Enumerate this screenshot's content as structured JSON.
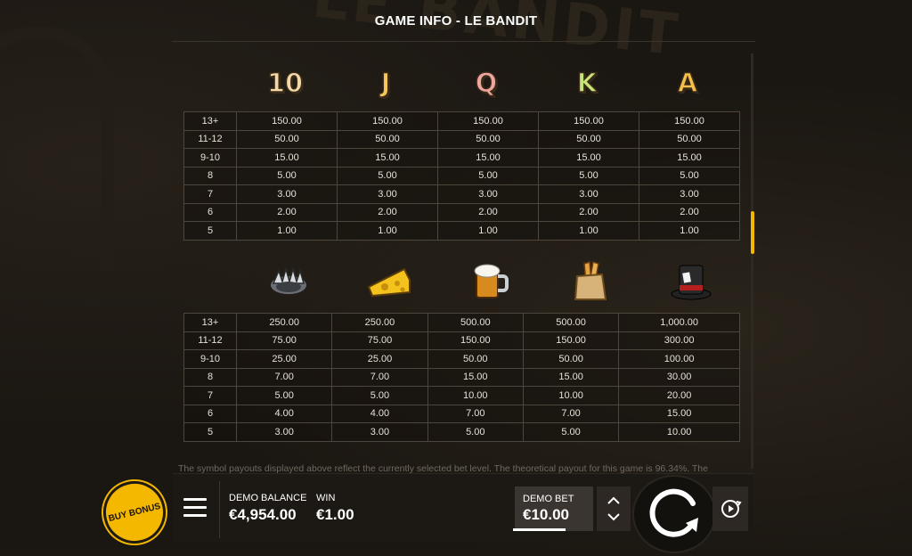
{
  "header": {
    "title": "GAME INFO - LE BANDIT"
  },
  "background": {
    "logo_text": "LE BANDIT"
  },
  "low_symbols": [
    {
      "name": "10",
      "color": "#f3d9a8"
    },
    {
      "name": "J",
      "color": "#f5c65a"
    },
    {
      "name": "Q",
      "color": "#f0a6a0"
    },
    {
      "name": "K",
      "color": "#c8e37a"
    },
    {
      "name": "A",
      "color": "#f6c14a"
    }
  ],
  "high_symbols": [
    {
      "name": "trap-icon"
    },
    {
      "name": "cheese-icon"
    },
    {
      "name": "beer-mug-icon"
    },
    {
      "name": "baguette-bag-icon"
    },
    {
      "name": "top-hat-icon"
    }
  ],
  "low_table": [
    [
      "13+",
      "150.00",
      "150.00",
      "150.00",
      "150.00",
      "150.00"
    ],
    [
      "11-12",
      "50.00",
      "50.00",
      "50.00",
      "50.00",
      "50.00"
    ],
    [
      "9-10",
      "15.00",
      "15.00",
      "15.00",
      "15.00",
      "15.00"
    ],
    [
      "8",
      "5.00",
      "5.00",
      "5.00",
      "5.00",
      "5.00"
    ],
    [
      "7",
      "3.00",
      "3.00",
      "3.00",
      "3.00",
      "3.00"
    ],
    [
      "6",
      "2.00",
      "2.00",
      "2.00",
      "2.00",
      "2.00"
    ],
    [
      "5",
      "1.00",
      "1.00",
      "1.00",
      "1.00",
      "1.00"
    ]
  ],
  "high_table": [
    [
      "13+",
      "250.00",
      "250.00",
      "500.00",
      "500.00",
      "1,000.00"
    ],
    [
      "11-12",
      "75.00",
      "75.00",
      "150.00",
      "150.00",
      "300.00"
    ],
    [
      "9-10",
      "25.00",
      "25.00",
      "50.00",
      "50.00",
      "100.00"
    ],
    [
      "8",
      "7.00",
      "7.00",
      "15.00",
      "15.00",
      "30.00"
    ],
    [
      "7",
      "5.00",
      "5.00",
      "10.00",
      "10.00",
      "20.00"
    ],
    [
      "6",
      "4.00",
      "4.00",
      "7.00",
      "7.00",
      "15.00"
    ],
    [
      "5",
      "3.00",
      "3.00",
      "5.00",
      "5.00",
      "10.00"
    ]
  ],
  "footnote": "The symbol payouts displayed above reflect the currently selected bet level. The theoretical payout for this game is 96.34%. The",
  "bottom": {
    "buy_bonus": "BUY BONUS",
    "balance_label": "DEMO BALANCE",
    "balance_value": "€4,954.00",
    "win_label": "WIN",
    "win_value": "€1.00",
    "bet_label": "DEMO BET",
    "bet_value": "€10.00"
  },
  "colors": {
    "accent": "#f5b800",
    "grid": "#4c463c"
  }
}
